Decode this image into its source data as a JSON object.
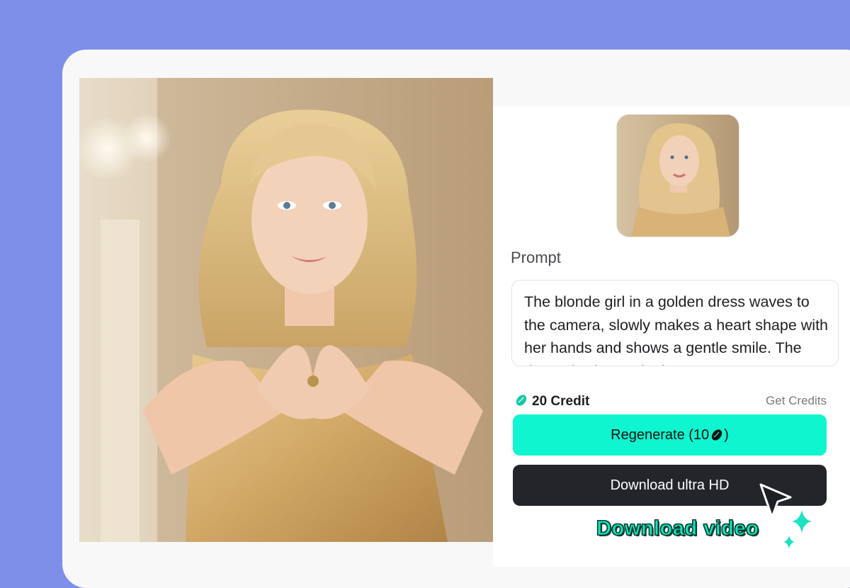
{
  "preview": {
    "main_image": "generated-portrait-blonde-golden-dress",
    "thumbnail": "source-portrait-thumbnail"
  },
  "prompt": {
    "label": "Prompt",
    "text": "The blonde girl in a golden dress waves to the camera, slowly makes a heart shape with her hands and shows a gentle smile. The dramatic change in the"
  },
  "credits": {
    "balance": "20 Credit",
    "get_credits_label": "Get Credits",
    "icon": "bean-icon"
  },
  "actions": {
    "regenerate_label": "Regenerate (10",
    "regenerate_suffix": ")",
    "download_label": "Download ultra HD"
  },
  "annotation": {
    "caption": "Download video"
  },
  "colors": {
    "background": "#7d8fe8",
    "accent": "#0ff5cf",
    "dark_button": "#23252b",
    "caption": "#0ee8bb"
  }
}
